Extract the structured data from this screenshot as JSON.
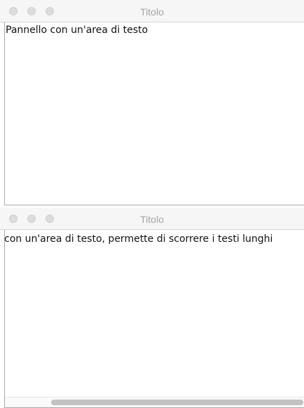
{
  "windows": [
    {
      "title": "Titolo",
      "text": "Pannello con un'area di testo"
    },
    {
      "title": "Titolo",
      "text": "con un'area di testo, permette di scorrere i testi lunghi",
      "horizontal_scroll_position": "scrolled to the right"
    }
  ]
}
